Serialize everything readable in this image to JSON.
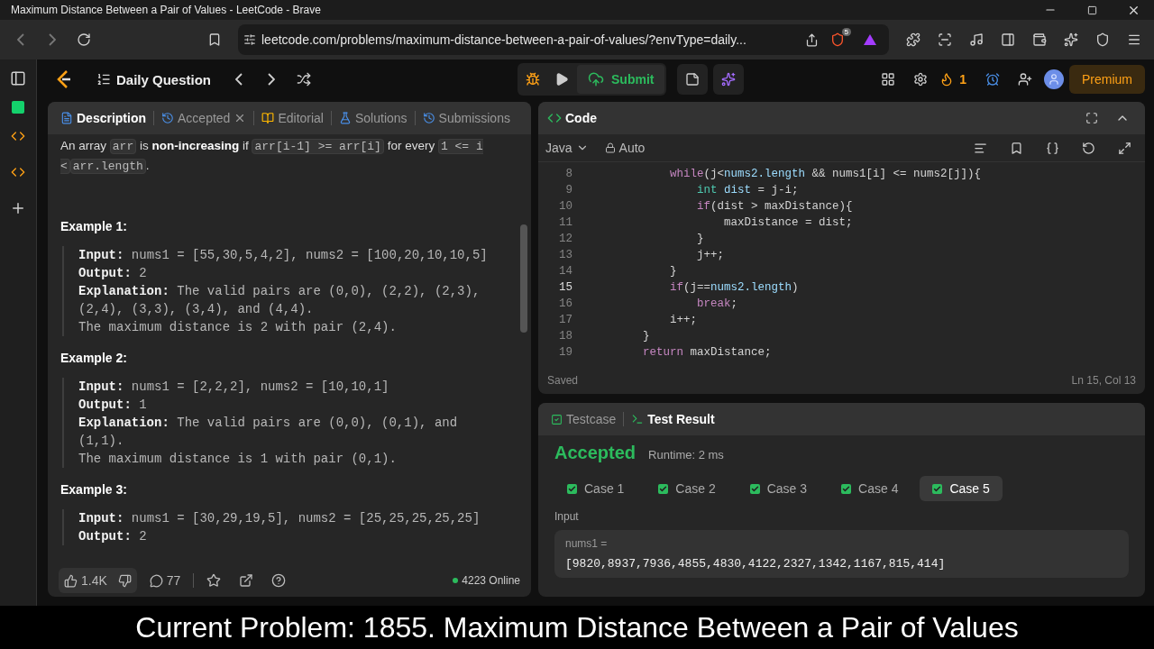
{
  "window": {
    "title": "Maximum Distance Between a Pair of Values - LeetCode - Brave"
  },
  "browser": {
    "url": "leetcode.com/problems/maximum-distance-between-a-pair-of-values/?envType=daily...",
    "shield_badge": "5"
  },
  "header": {
    "title": "Daily Question",
    "submit": "Submit",
    "streak": "1",
    "premium": "Premium"
  },
  "left_tabs": [
    {
      "label": "Description",
      "selected": true,
      "closable": false
    },
    {
      "label": "Accepted",
      "selected": false,
      "closable": true
    },
    {
      "label": "Editorial",
      "selected": false,
      "closable": false
    },
    {
      "label": "Solutions",
      "selected": false,
      "closable": false
    },
    {
      "label": "Submissions",
      "selected": false,
      "closable": false
    }
  ],
  "description": {
    "intro": [
      {
        "kind": "text",
        "text": "An array "
      },
      {
        "kind": "code",
        "text": "arr"
      },
      {
        "kind": "text",
        "text": " is "
      },
      {
        "kind": "bold",
        "text": "non-increasing"
      },
      {
        "kind": "text",
        "text": " if "
      },
      {
        "kind": "code",
        "text": "arr[i-1] >= arr[i]"
      },
      {
        "kind": "text",
        "text": " for every "
      },
      {
        "kind": "code",
        "text": "1 <= i <"
      },
      {
        "kind": "code",
        "text": "arr.length"
      },
      {
        "kind": "text",
        "text": "."
      }
    ],
    "examples": [
      {
        "title": "Example 1:",
        "lines": [
          {
            "label": "Input:",
            "text": "nums1 = [55,30,5,4,2], nums2 = [100,20,10,10,5]"
          },
          {
            "label": "Output:",
            "text": "2"
          },
          {
            "label": "Explanation:",
            "text": "The valid pairs are (0,0), (2,2), (2,3), (2,4), (3,3), (3,4), and (4,4)."
          },
          {
            "text": "The maximum distance is 2 with pair (2,4)."
          }
        ]
      },
      {
        "title": "Example 2:",
        "lines": [
          {
            "label": "Input:",
            "text": "nums1 = [2,2,2], nums2 = [10,10,1]"
          },
          {
            "label": "Output:",
            "text": "1"
          },
          {
            "label": "Explanation:",
            "text": "The valid pairs are (0,0), (0,1), and (1,1)."
          },
          {
            "text": "The maximum distance is 1 with pair (0,1)."
          }
        ]
      },
      {
        "title": "Example 3:",
        "lines": [
          {
            "label": "Input:",
            "text": "nums1 = [30,29,19,5], nums2 = [25,25,25,25,25]"
          },
          {
            "label": "Output:",
            "text": "2"
          }
        ]
      }
    ]
  },
  "left_footer": {
    "likes": "1.4K",
    "comments": "77",
    "online": "4223 Online"
  },
  "code": {
    "title": "Code",
    "language": "Java",
    "mode": "Auto",
    "status": "Saved",
    "cursor": "Ln 15, Col 13",
    "lines": [
      {
        "number": "8",
        "current": false,
        "tokens": [
          {
            "kind": "keyword",
            "text": "            while"
          },
          {
            "kind": "plain",
            "text": "(j<"
          },
          {
            "kind": "field",
            "text": "nums2.length"
          },
          {
            "kind": "plain",
            "text": " && nums1[i] <= nums2[j]){"
          }
        ]
      },
      {
        "number": "9",
        "current": false,
        "tokens": [
          {
            "kind": "type",
            "text": "                int"
          },
          {
            "kind": "field",
            "text": " dist"
          },
          {
            "kind": "plain",
            "text": " = j-i;"
          }
        ]
      },
      {
        "number": "10",
        "current": false,
        "tokens": [
          {
            "kind": "keyword",
            "text": "                if"
          },
          {
            "kind": "plain",
            "text": "(dist > maxDistance){"
          }
        ]
      },
      {
        "number": "11",
        "current": false,
        "tokens": [
          {
            "kind": "plain",
            "text": "                    maxDistance = dist;"
          }
        ]
      },
      {
        "number": "12",
        "current": false,
        "tokens": [
          {
            "kind": "plain",
            "text": "                }"
          }
        ]
      },
      {
        "number": "13",
        "current": false,
        "tokens": [
          {
            "kind": "plain",
            "text": "                j++;"
          }
        ]
      },
      {
        "number": "14",
        "current": false,
        "tokens": [
          {
            "kind": "plain",
            "text": "            }"
          }
        ]
      },
      {
        "number": "15",
        "current": true,
        "tokens": [
          {
            "kind": "keyword",
            "text": "            if"
          },
          {
            "kind": "plain",
            "text": "(j=="
          },
          {
            "kind": "field",
            "text": "nums2.length"
          },
          {
            "kind": "plain",
            "text": ")"
          }
        ]
      },
      {
        "number": "16",
        "current": false,
        "tokens": [
          {
            "kind": "keyword",
            "text": "                break"
          },
          {
            "kind": "plain",
            "text": ";"
          }
        ]
      },
      {
        "number": "17",
        "current": false,
        "tokens": [
          {
            "kind": "plain",
            "text": "            i++;"
          }
        ]
      },
      {
        "number": "18",
        "current": false,
        "tokens": [
          {
            "kind": "plain",
            "text": "        }"
          }
        ]
      },
      {
        "number": "19",
        "current": false,
        "tokens": [
          {
            "kind": "keyword",
            "text": "        return"
          },
          {
            "kind": "plain",
            "text": " maxDistance;"
          }
        ]
      }
    ]
  },
  "test_tabs": [
    {
      "label": "Testcase",
      "selected": false
    },
    {
      "label": "Test Result",
      "selected": true
    }
  ],
  "result": {
    "verdict": "Accepted",
    "runtime": "Runtime: 2 ms",
    "cases": [
      {
        "label": "Case 1",
        "passed": true,
        "selected": false
      },
      {
        "label": "Case 2",
        "passed": true,
        "selected": false
      },
      {
        "label": "Case 3",
        "passed": true,
        "selected": false
      },
      {
        "label": "Case 4",
        "passed": true,
        "selected": false
      },
      {
        "label": "Case 5",
        "passed": true,
        "selected": true
      }
    ],
    "input_label": "Input",
    "param_name": "nums1 =",
    "param_value": "[9820,8937,7936,4855,4830,4122,2327,1342,1167,815,414]"
  },
  "caption": "Current Problem: 1855. Maximum Distance Between a Pair of Values"
}
